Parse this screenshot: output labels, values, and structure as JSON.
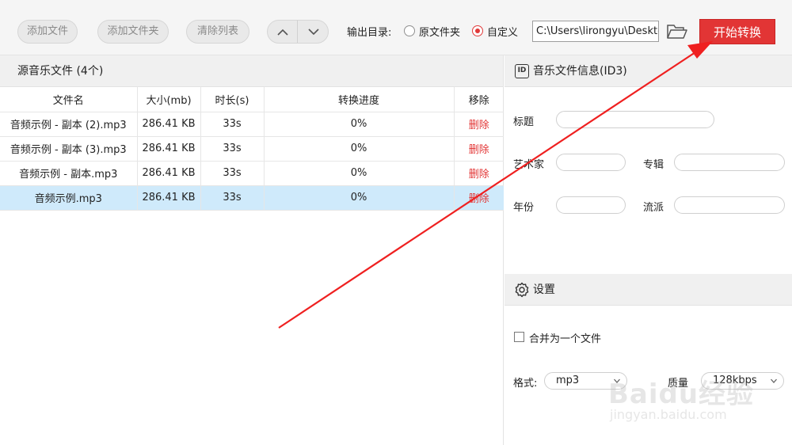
{
  "toolbar": {
    "add_file": "添加文件",
    "add_folder": "添加文件夹",
    "clear_list": "清除列表",
    "output_dir_label": "输出目录:",
    "radio_original": "原文件夹",
    "radio_custom": "自定义",
    "radio_selected": "custom",
    "output_path": "C:\\Users\\lirongyu\\Desktop",
    "start_button": "开始转换",
    "accent_color": "#e23535"
  },
  "file_list": {
    "header": "源音乐文件 (4个)",
    "columns": [
      "文件名",
      "大小(mb)",
      "时长(s)",
      "转换进度",
      "移除"
    ],
    "rows": [
      {
        "name": "音频示例 - 副本 (2).mp3",
        "size": "286.41 KB",
        "duration": "33s",
        "progress": "0%",
        "remove": "删除"
      },
      {
        "name": "音频示例 - 副本 (3).mp3",
        "size": "286.41 KB",
        "duration": "33s",
        "progress": "0%",
        "remove": "删除"
      },
      {
        "name": "音频示例 - 副本.mp3",
        "size": "286.41 KB",
        "duration": "33s",
        "progress": "0%",
        "remove": "删除"
      },
      {
        "name": "音频示例.mp3",
        "size": "286.41 KB",
        "duration": "33s",
        "progress": "0%",
        "remove": "删除"
      }
    ],
    "selected_row": 3,
    "selected_color": "#cfeafb"
  },
  "id3": {
    "header": "音乐文件信息(ID3)",
    "icon_text": "ID",
    "title_label": "标题",
    "artist_label": "艺术家",
    "album_label": "专辑",
    "year_label": "年份",
    "genre_label": "流派"
  },
  "settings": {
    "header": "设置",
    "merge_label": "合并为一个文件",
    "format_label": "格式:",
    "format_value": "mp3",
    "quality_label": "质量",
    "quality_value": "128kbps"
  },
  "watermark": {
    "main": "Baidu经验",
    "sub": "jingyan.baidu.com"
  },
  "icons": {
    "up": "chevron-up-icon",
    "down": "chevron-down-icon",
    "folder": "folder-open-icon",
    "id3": "id-icon",
    "settings": "gear-icon"
  }
}
